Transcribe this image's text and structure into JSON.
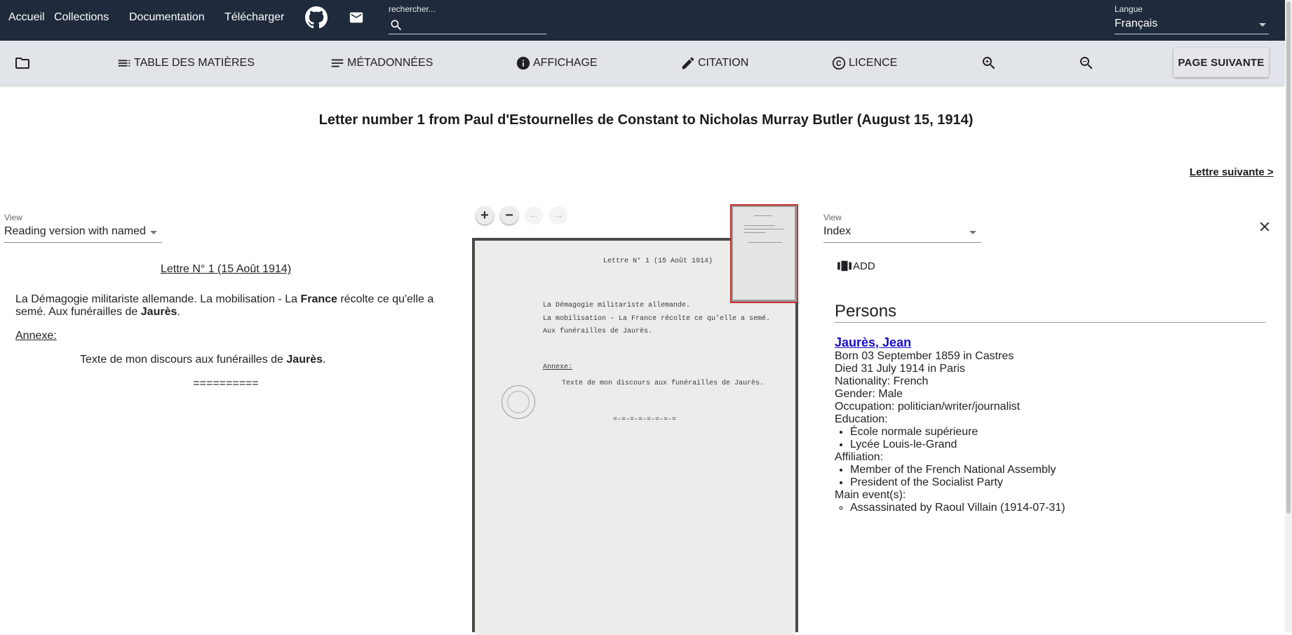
{
  "nav": {
    "home": "Accueil",
    "collections": "Collections",
    "documentation": "Documentation",
    "download": "Télécharger",
    "search_placeholder": "rechercher...",
    "language_label": "Langue",
    "language_value": "Français"
  },
  "toolbar": {
    "toc": "TABLE DES MATIÈRES",
    "metadata": "MÉTADONNÉES",
    "display": "AFFICHAGE",
    "citation": "CITATION",
    "license": "LICENCE",
    "next_page": "PAGE SUIVANTE"
  },
  "document": {
    "title": "Letter number 1 from Paul d'Estournelles de Constant to Nicholas Murray Butler (August 15, 1914)",
    "next_letter": "Lettre suivante >"
  },
  "left_view": {
    "label": "View",
    "value": "Reading version with named"
  },
  "transcription": {
    "heading": "Lettre N° 1 (15 Août 1914)",
    "p1_a": "La Démagogie militariste allemande. La mobilisation - La ",
    "p1_b": "France",
    "p1_c": " récolte ce qu'elle a semé. Aux funérailles de ",
    "p1_d": "Jaurès",
    "p1_e": ".",
    "annex": "Annexe:",
    "disc_a": "Texte de mon discours aux funérailles de ",
    "disc_b": "Jaurès",
    "disc_c": ".",
    "separator": "=========="
  },
  "scan": {
    "line_heading": "Lettre N° 1  (15 Août 1914)",
    "line1": "La Démagogie militariste allemande.",
    "line2": "La mobilisation - La France récolte ce qu'elle a semé.",
    "line3": "Aux funérailles de Jaurès.",
    "annex": "Annexe:",
    "line4": "Texte de mon discours aux funérailles de Jaurès.",
    "separator": "=-=-=-=-=-=-=-="
  },
  "right_view": {
    "label": "View",
    "value": "Index",
    "add_label": "ADD"
  },
  "persons": {
    "heading": "Persons",
    "name": "Jaurès, Jean",
    "born": "Born 03 September 1859 in Castres",
    "died": "Died 31 July 1914 in Paris",
    "nationality": "Nationality: French",
    "gender": "Gender: Male",
    "occupation": "Occupation: politician/writer/journalist",
    "education_label": "Education:",
    "education": [
      "École normale supérieure",
      "Lycée Louis-le-Grand"
    ],
    "affiliation_label": "Affiliation:",
    "affiliation": [
      "Member of the French National Assembly",
      "President of the Socialist Party"
    ],
    "events_label": "Main event(s):",
    "events": [
      "Assassinated by Raoul Villain (1914-07-31)"
    ]
  },
  "icons": {
    "github": "github-icon",
    "mail": "mail-icon",
    "search": "search-icon",
    "folder": "folder-icon",
    "toc": "toc-icon",
    "metadata": "notes-icon",
    "display": "info-icon",
    "citation": "pencil-icon",
    "license": "copyright-icon",
    "zoom_in": "zoom-in-icon",
    "zoom_out": "zoom-out-icon",
    "close": "close-icon",
    "add": "view-column-icon"
  },
  "colors": {
    "topbar": "#1f2a3c",
    "toolbar": "#e1e4e8",
    "link": "#1a0dcc",
    "minimap_frame": "#c62b2b"
  }
}
